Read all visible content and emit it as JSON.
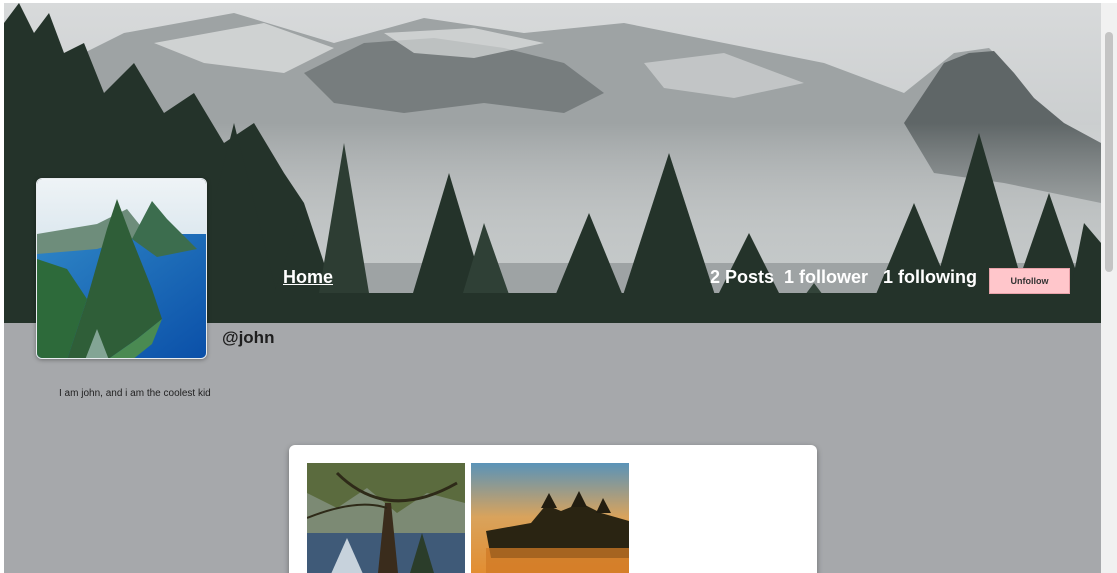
{
  "profile": {
    "username": "@john",
    "bio": "I am john, and i am the coolest kid"
  },
  "nav": {
    "home_label": "Home"
  },
  "stats": {
    "posts": "2 Posts",
    "followers": "1 follower",
    "following": "1 following"
  },
  "actions": {
    "unfollow_label": "Unfollow"
  },
  "colors": {
    "page_background": "#a6a8ab",
    "unfollow_button": "#ffc6cb",
    "card_background": "#ffffff"
  },
  "posts": [
    {
      "thumbnail": "tree-landscape-image"
    },
    {
      "thumbnail": "sunset-lake-image"
    }
  ]
}
